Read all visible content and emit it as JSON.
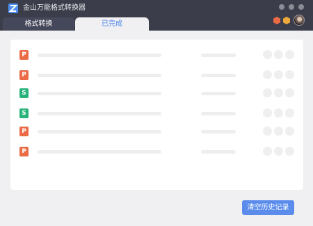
{
  "window": {
    "title": "金山万能格式转换器",
    "accent": "#5b8cec"
  },
  "tabs": [
    {
      "label": "格式转换",
      "selected": false
    },
    {
      "label": "已完成",
      "selected": true
    }
  ],
  "header_icons": [
    "hexagon-icon-orange",
    "hexagon-icon-yellow",
    "avatar"
  ],
  "file_list": {
    "rows": [
      {
        "type": "ppt",
        "glyph": "P"
      },
      {
        "type": "ppt",
        "glyph": "P"
      },
      {
        "type": "sheet",
        "glyph": "S"
      },
      {
        "type": "sheet",
        "glyph": "S"
      },
      {
        "type": "ppt",
        "glyph": "P"
      },
      {
        "type": "ppt",
        "glyph": "P"
      }
    ]
  },
  "footer": {
    "clear_history_label": "清空历史记录"
  }
}
